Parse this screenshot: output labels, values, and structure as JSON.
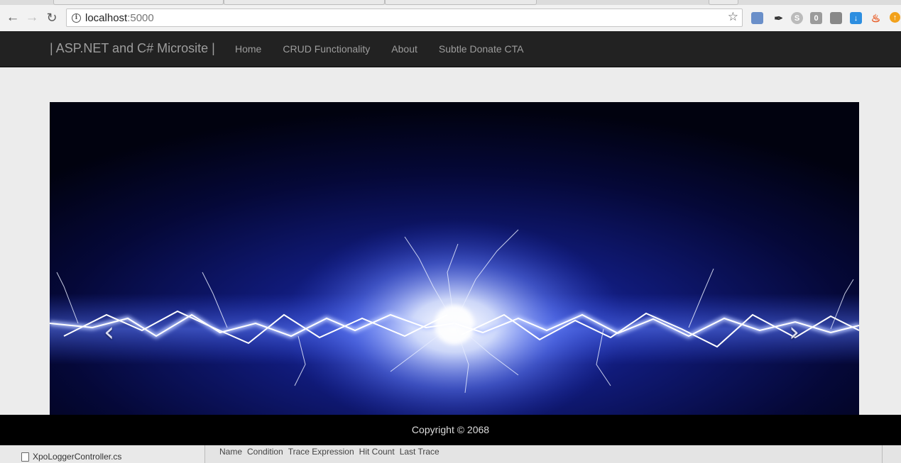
{
  "browser": {
    "url_host": "localhost",
    "url_port": ":5000",
    "icons": [
      "back-icon",
      "forward-icon",
      "reload-icon",
      "info-icon",
      "star-icon"
    ],
    "extension_badge": "0"
  },
  "navbar": {
    "brand": "| ASP.NET and C# Microsite |",
    "links": [
      "Home",
      "CRUD Functionality",
      "About",
      "Subtle Donate CTA"
    ]
  },
  "carousel": {
    "prev_icon": "chevron-left-icon",
    "next_icon": "chevron-right-icon",
    "prev_glyph": "‹",
    "next_glyph": "›"
  },
  "footer": {
    "copyright": "Copyright © 2068"
  },
  "ide": {
    "file": "XpoLoggerController.cs",
    "columns": [
      "Name",
      "Condition",
      "Trace Expression",
      "Hit Count",
      "Last Trace"
    ]
  },
  "colors": {
    "navbar_bg": "#222222",
    "nav_text": "#9d9d9d",
    "page_bg": "#ececec",
    "footer_bg": "#000000"
  }
}
